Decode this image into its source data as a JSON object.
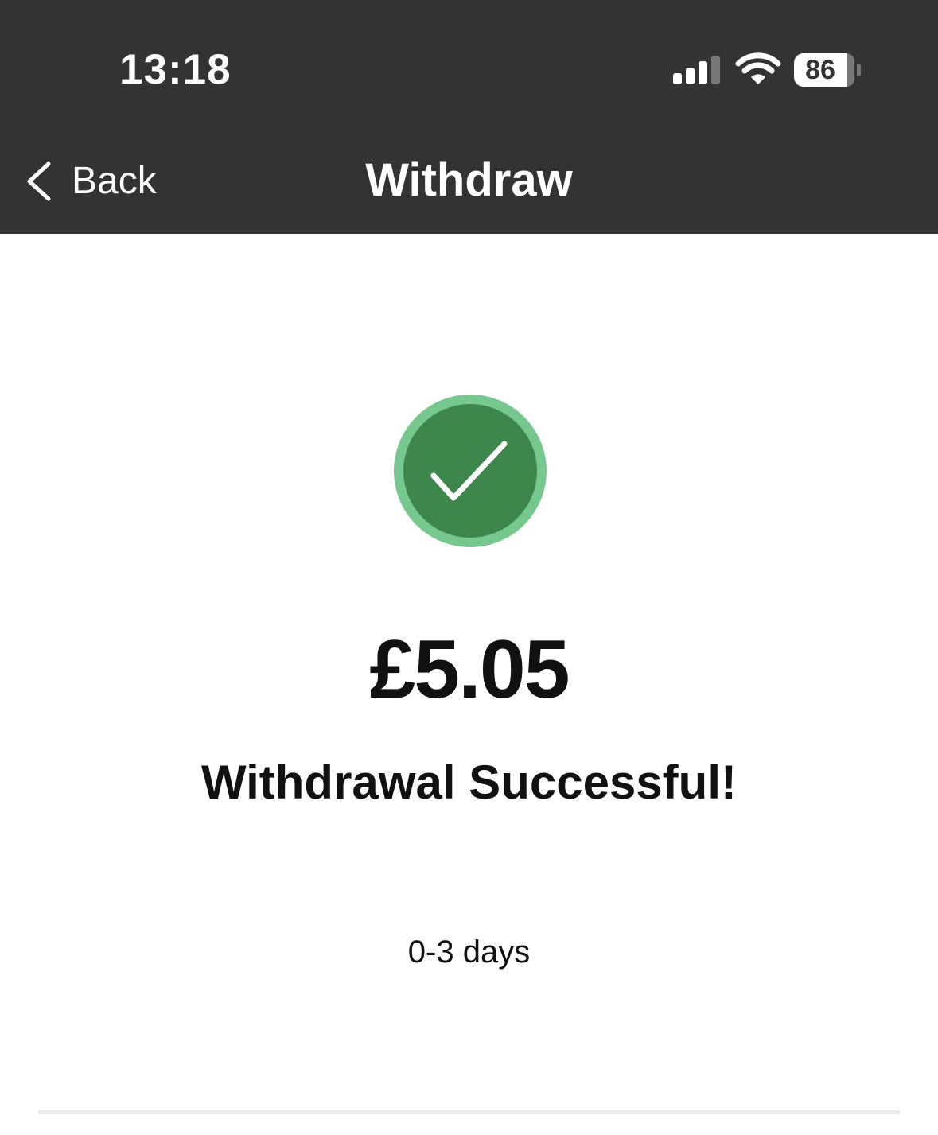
{
  "status_bar": {
    "time": "13:18",
    "battery": "86",
    "icons": [
      "cellular-signal-icon",
      "wifi-icon",
      "battery-icon"
    ]
  },
  "nav": {
    "back_label": "Back",
    "title": "Withdraw"
  },
  "result": {
    "amount": "£5.05",
    "message": "Withdrawal Successful!",
    "eta": "0-3 days",
    "icon": "checkmark-circle-icon"
  },
  "colors": {
    "header_bg": "#333333",
    "success_ring": "#76c88f",
    "success_fill": "#3d874d",
    "text": "#111111"
  }
}
